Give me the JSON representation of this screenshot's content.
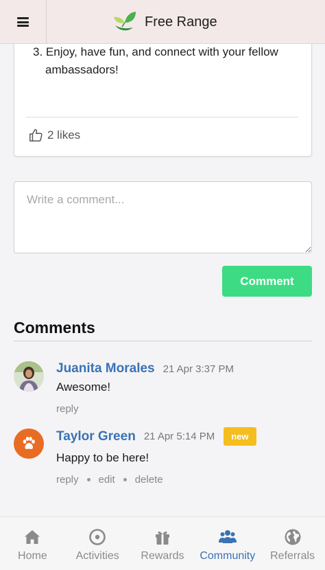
{
  "header": {
    "app_name": "Free Range"
  },
  "post": {
    "step_text": "3. Enjoy, have fun, and connect with your fellow ambassadors!",
    "likes": "2 likes"
  },
  "comment_form": {
    "placeholder": "Write a comment...",
    "submit_label": "Comment"
  },
  "comments": {
    "title": "Comments",
    "items": [
      {
        "author": "Juanita Morales",
        "time": "21 Apr 3:37 PM",
        "text": "Awesome!",
        "reply": "reply"
      },
      {
        "author": "Taylor Green",
        "time": "21 Apr 5:14 PM",
        "badge": "new",
        "text": "Happy to be here!",
        "reply": "reply",
        "edit": "edit",
        "delete": "delete"
      }
    ]
  },
  "nav": {
    "items": [
      {
        "label": "Home",
        "icon": "home-icon"
      },
      {
        "label": "Activities",
        "icon": "target-icon"
      },
      {
        "label": "Rewards",
        "icon": "gift-icon"
      },
      {
        "label": "Community",
        "icon": "users-icon",
        "active": true
      },
      {
        "label": "Referrals",
        "icon": "globe-icon"
      }
    ]
  },
  "colors": {
    "header_bg": "#f3e9e8",
    "accent_blue": "#3a72b4",
    "button_green": "#3ddc84",
    "badge_yellow": "#f5bd1f",
    "avatar_orange": "#e86c23"
  }
}
